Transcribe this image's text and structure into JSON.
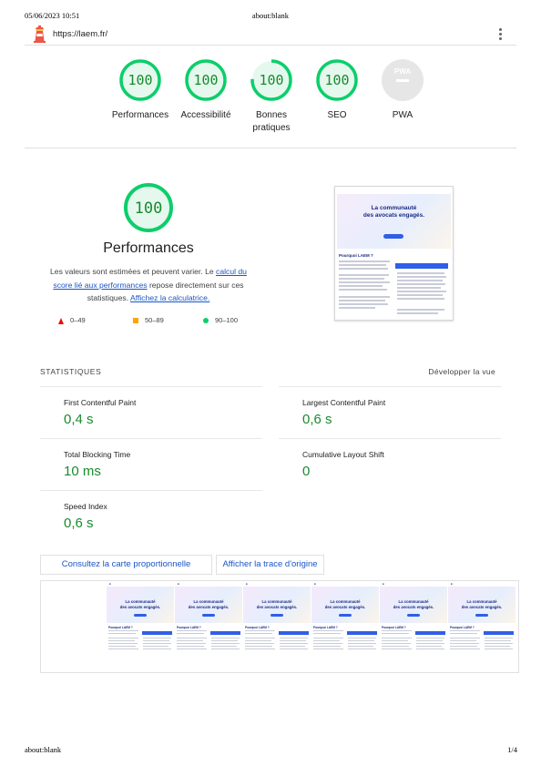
{
  "print": {
    "datetime": "05/06/2023 10:51",
    "title": "about:blank",
    "footer_url": "about:blank",
    "page_count": "1/4"
  },
  "topbar": {
    "url": "https://laem.fr/"
  },
  "gauges": [
    {
      "score": "100",
      "label": "Performances"
    },
    {
      "score": "100",
      "label": "Accessibilité"
    },
    {
      "score": "100",
      "label": "Bonnes pratiques"
    },
    {
      "score": "100",
      "label": "SEO"
    },
    {
      "score": "PWA",
      "label": "PWA"
    }
  ],
  "performance": {
    "score": "100",
    "title": "Performances",
    "desc_before": "Les valeurs sont estimées et peuvent varier. Le ",
    "desc_link1": "calcul du score lié aux performances",
    "desc_middle": " repose directement sur ces statistiques. ",
    "desc_link2": "Affichez la calculatrice.",
    "legend": [
      "0–49",
      "50–89",
      "90–100"
    ]
  },
  "screenshot": {
    "hero_line1": "La communauté",
    "hero_line2": "des avocats engagés.",
    "section_heading": "Pourquoi LAEM ?"
  },
  "stats": {
    "heading": "STATISTIQUES",
    "expand_label": "Développer la vue",
    "metrics": [
      {
        "title": "First Contentful Paint",
        "value": "0,4 s"
      },
      {
        "title": "Largest Contentful Paint",
        "value": "0,6 s"
      },
      {
        "title": "Total Blocking Time",
        "value": "10 ms"
      },
      {
        "title": "Cumulative Layout Shift",
        "value": "0"
      },
      {
        "title": "Speed Index",
        "value": "0,6 s"
      }
    ]
  },
  "actions": {
    "treemap": "Consultez la carte proportionnelle",
    "trace": "Afficher la trace d'origine"
  },
  "filmstrip": {
    "frame_line1": "La communauté",
    "frame_line2": "des avocats engagés.",
    "frame_heading": "Pourquoi LAEM ?"
  },
  "colors": {
    "pass_green": "#0cce6b",
    "pass_text": "#188b2d",
    "average_orange": "#ffa400",
    "fail_red": "#eb0f00",
    "link_blue": "#1a55c4"
  }
}
